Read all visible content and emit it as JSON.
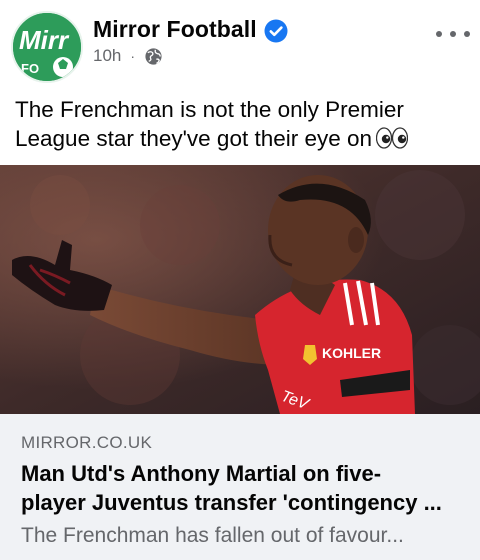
{
  "post": {
    "page_name": "Mirror Football",
    "avatar_icon": "mirror-football-logo",
    "verified_icon": "verified-badge-icon",
    "time": "10h",
    "separator": "·",
    "audience_icon": "globe-icon",
    "more_icon": "more-options-icon",
    "text": "The Frenchman is not the only Premier League star they've got their eye on",
    "emoji_icon": "eyes-emoji"
  },
  "link": {
    "image_description_icon": "footballer-photo",
    "domain": "MIRROR.CO.UK",
    "title_line1": "Man Utd's Anthony Martial on five-",
    "title_line2": "player Juventus transfer 'contingency ...",
    "description": "The Frenchman has fallen out of favour..."
  },
  "colors": {
    "brand_green": "#2d9c5a",
    "verified_blue": "#1877f2",
    "secondary_text": "#65676b",
    "link_background": "#f0f2f5",
    "shirt_red": "#d6252e"
  }
}
